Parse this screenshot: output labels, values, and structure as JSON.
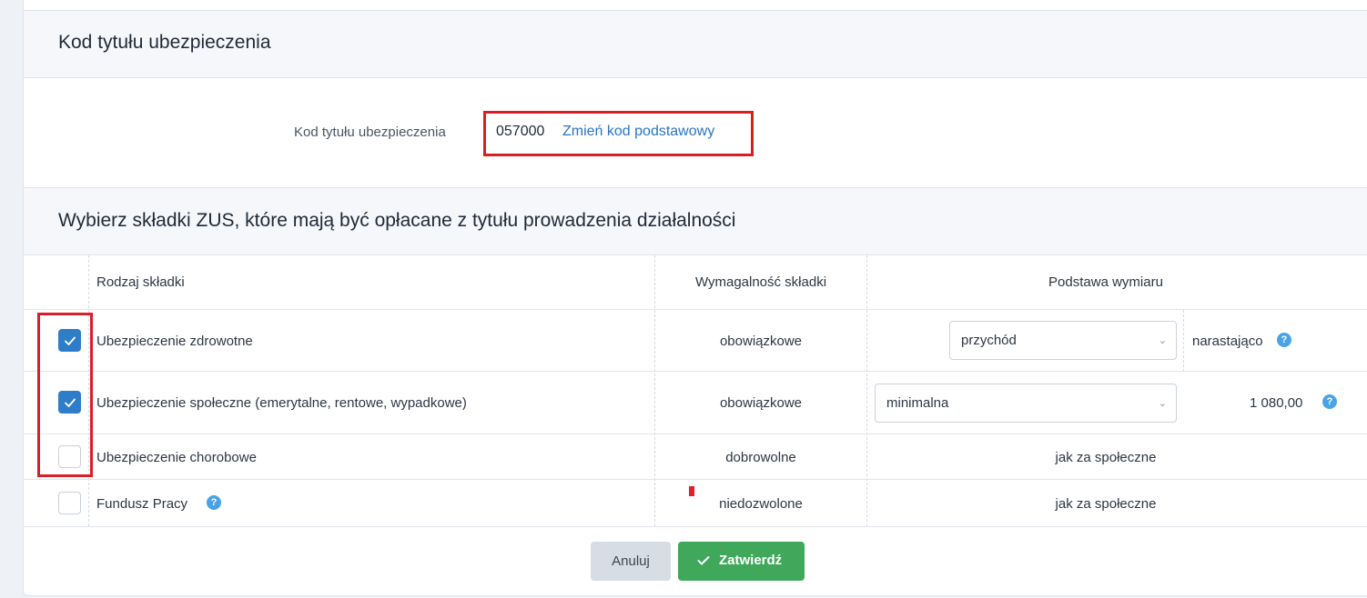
{
  "section1": {
    "title": "Kod tytułu ubezpieczenia",
    "field_label": "Kod tytułu ubezpieczenia",
    "code": "057000",
    "change_link": "Zmień kod podstawowy"
  },
  "section2": {
    "title": "Wybierz składki ZUS, które mają być opłacane z tytułu prowadzenia działalności",
    "columns": {
      "type": "Rodzaj składki",
      "requirement": "Wymagalność składki",
      "basis": "Podstawa wymiaru"
    },
    "rows": [
      {
        "name": "Ubezpieczenie zdrowotne",
        "checked": true,
        "requirement": "obowiązkowe",
        "basis_select": "przychód",
        "basis_extra": "narastająco"
      },
      {
        "name": "Ubezpieczenie społeczne (emerytalne, rentowe, wypadkowe)",
        "checked": true,
        "requirement": "obowiązkowe",
        "basis_select": "minimalna",
        "basis_extra": "1 080,00"
      },
      {
        "name": "Ubezpieczenie chorobowe",
        "checked": false,
        "requirement": "dobrowolne",
        "basis_text": "jak za społeczne"
      },
      {
        "name": "Fundusz Pracy",
        "checked": false,
        "requirement": "niedozwolone",
        "basis_text": "jak za społeczne"
      }
    ]
  },
  "actions": {
    "cancel": "Anuluj",
    "confirm": "Zatwierdź"
  },
  "icons": {
    "help": "?",
    "chevron": "⌄"
  },
  "colors": {
    "accent": "#2f7dc8",
    "link": "#2b74c2",
    "confirm": "#3fa85a",
    "highlight": "#d91f26"
  }
}
